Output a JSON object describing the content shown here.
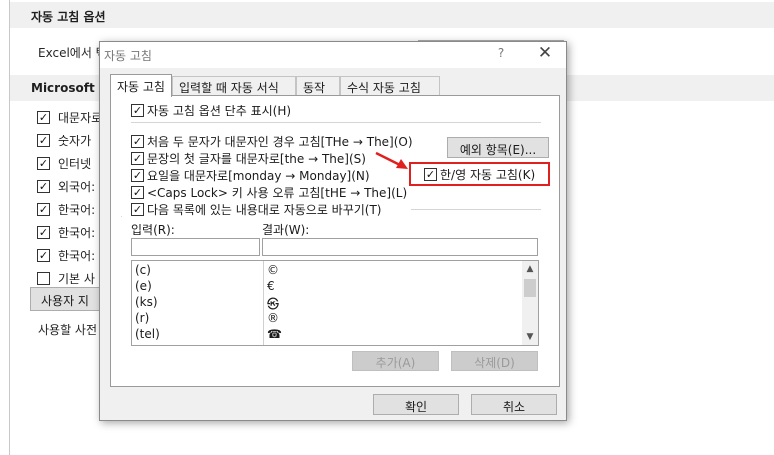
{
  "background": {
    "section1_header": "자동 고침 옵션",
    "excel_text": "Excel에서 텍",
    "section2_header": "Microsoft Of",
    "checkboxes": [
      {
        "label": "대문자로",
        "checked": true
      },
      {
        "label": "숫자가",
        "checked": true
      },
      {
        "label": "인터넷",
        "checked": true
      },
      {
        "label": "외국어:",
        "checked": true
      },
      {
        "label": "한국어:",
        "checked": true
      },
      {
        "label": "한국어:",
        "checked": true
      },
      {
        "label": "한국어:",
        "checked": true
      },
      {
        "label": "기본 사",
        "checked": false
      }
    ],
    "user_dict_button": "사용자 지",
    "dict_text": "사용할 사전"
  },
  "dialog": {
    "title": "자동 고침",
    "help": "?",
    "close": "✕",
    "tabs": [
      "자동 고침",
      "입력할 때 자동 서식",
      "동작",
      "수식 자동 고침"
    ],
    "active_tab": 0,
    "show_options_label": "자동 고침 옵션 단추 표시(H)",
    "show_options_checked": true,
    "options": [
      {
        "label": "처음 두 문자가 대문자인 경우 고침[THe → The](O)",
        "checked": true
      },
      {
        "label": "문장의 첫 글자를 대문자로[the → The](S)",
        "checked": true
      },
      {
        "label": "요일을 대문자로[monday → Monday](N)",
        "checked": true
      },
      {
        "label": "<Caps Lock> 키 사용 오류 고침[tHE → The](L)",
        "checked": true
      },
      {
        "label": "다음 목록에 있는 내용대로 자동으로 바꾸기(T)",
        "checked": true
      }
    ],
    "exceptions_button": "예외 항목(E)...",
    "hanyoung_label": "한/영 자동 고침(K)",
    "hanyoung_checked": true,
    "highlight_color": "#e01f1f",
    "input_label": "입력(R):",
    "result_label": "결과(W):",
    "input_value": "",
    "result_value": "",
    "list": [
      {
        "input": "(c)",
        "output": "©"
      },
      {
        "input": "(e)",
        "output": "€"
      },
      {
        "input": "(ks)",
        "output": "㉿"
      },
      {
        "input": "(r)",
        "output": "®"
      },
      {
        "input": "(tel)",
        "output": "☎"
      }
    ],
    "add_button": "추가(A)",
    "delete_button": "삭제(D)",
    "ok_button": "확인",
    "cancel_button": "취소"
  }
}
